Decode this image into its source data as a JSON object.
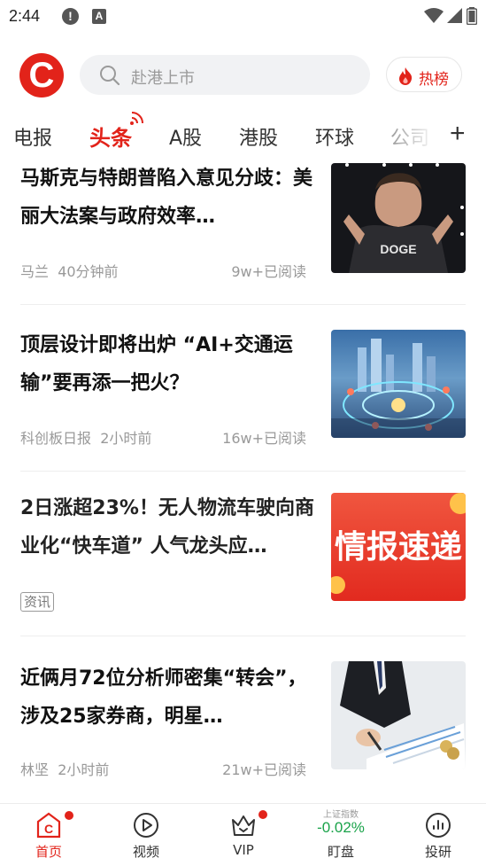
{
  "status_bar": {
    "time": "2:44"
  },
  "header": {
    "logo_letter": "C",
    "search_placeholder": "赴港上市",
    "hot_label": "热榜"
  },
  "tabs": [
    "电报",
    "头条",
    "A股",
    "港股",
    "环球",
    "公司"
  ],
  "active_tab": "头条",
  "articles": [
    {
      "title": "马斯克与特朗普陷入意见分歧：美丽大法案与政府效率…",
      "source": "马兰",
      "time": "40分钟前",
      "reads": "9w+已阅读",
      "thumb_text": "DOGE"
    },
    {
      "title": "顶层设计即将出炉 “AI+交通运输”要再添一把火？",
      "source": "科创板日报",
      "time": "2小时前",
      "reads": "16w+已阅读"
    },
    {
      "title": "2日涨超23%！无人物流车驶向商业化“快车道” 人气龙头应…",
      "tag": "资讯",
      "thumb_text": "情报速递"
    },
    {
      "title": "近俩月72位分析师密集“转会”，涉及25家券商，明星…",
      "source": "林坚",
      "time": "2小时前",
      "reads": "21w+已阅读"
    }
  ],
  "bottom_nav": [
    {
      "label": "首页",
      "icon": "home-c-icon",
      "active": true
    },
    {
      "label": "视频",
      "icon": "play-icon",
      "active": false
    },
    {
      "label": "VIP",
      "icon": "crown-icon",
      "active": false
    },
    {
      "label": "盯盘",
      "index_name": "上证指数",
      "index_value": "-0.02%",
      "active": false
    },
    {
      "label": "投研",
      "icon": "chart-gauge-icon",
      "active": false
    }
  ],
  "colors": {
    "brand_red": "#e2231a",
    "index_down_green": "#1aa34a",
    "muted_text": "#999999"
  }
}
